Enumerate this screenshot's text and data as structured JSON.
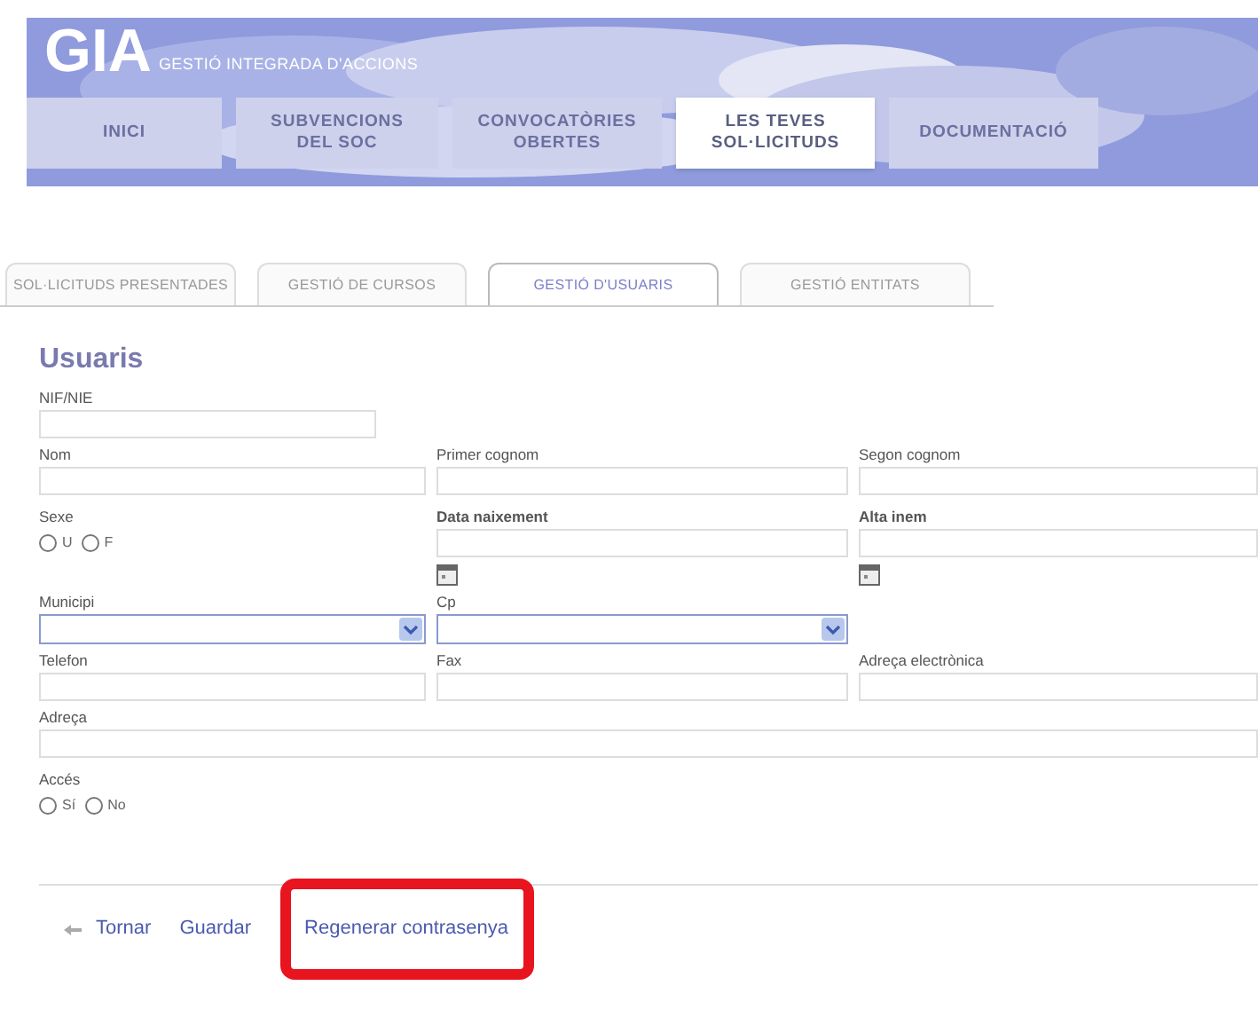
{
  "header": {
    "logo": "GIA",
    "subtitle": "GESTIÓ INTEGRADA D'ACCIONS"
  },
  "main_tabs": [
    {
      "label": "INICI",
      "selected": false
    },
    {
      "label": "SUBVENCIONS DEL SOC",
      "selected": false
    },
    {
      "label": "CONVOCATÒRIES OBERTES",
      "selected": false
    },
    {
      "label": "LES TEVES SOL·LICITUDS",
      "selected": true
    },
    {
      "label": "DOCUMENTACIÓ",
      "selected": false
    }
  ],
  "sub_tabs": [
    {
      "label": "SOL·LICITUDS PRESENTADES",
      "selected": false
    },
    {
      "label": "GESTIÓ DE CURSOS",
      "selected": false
    },
    {
      "label": "GESTIÓ D'USUARIS",
      "selected": true
    },
    {
      "label": "GESTIÓ ENTITATS",
      "selected": false
    }
  ],
  "form": {
    "title": "Usuaris",
    "rows": [
      [
        {
          "kind": "text",
          "label": "NIF/NIE"
        }
      ],
      [
        {
          "kind": "text",
          "label": "Nom"
        },
        {
          "kind": "text",
          "label": "Primer cognom"
        },
        {
          "kind": "text",
          "label": "Segon cognom"
        }
      ],
      [
        {
          "kind": "radio",
          "label": "Sexe",
          "options": [
            {
              "label": "U",
              "selected": false
            },
            {
              "label": "F",
              "selected": false
            }
          ]
        },
        {
          "kind": "date",
          "label": "Data naixement"
        },
        {
          "kind": "date",
          "label": "Alta inem"
        }
      ],
      [
        {
          "kind": "select",
          "label": "Municipi"
        },
        {
          "kind": "select",
          "label": "Cp"
        }
      ],
      [
        {
          "kind": "text",
          "label": "Telefon"
        },
        {
          "kind": "text",
          "label": "Fax"
        },
        {
          "kind": "text",
          "label": "Adreça electrònica"
        }
      ],
      [
        {
          "kind": "wide",
          "label": "Adreça"
        }
      ],
      [
        {
          "kind": "radio",
          "label": "Accés",
          "options": [
            {
              "label": "Sí",
              "selected": false
            },
            {
              "label": "No",
              "selected": false
            }
          ]
        }
      ]
    ]
  },
  "actions": [
    {
      "label": "Tornar",
      "kind": "back",
      "highlighted": false
    },
    {
      "label": "Guardar",
      "kind": "plain",
      "highlighted": false
    },
    {
      "label": "Regenerar contrasenya",
      "kind": "plain",
      "highlighted": true
    }
  ]
}
